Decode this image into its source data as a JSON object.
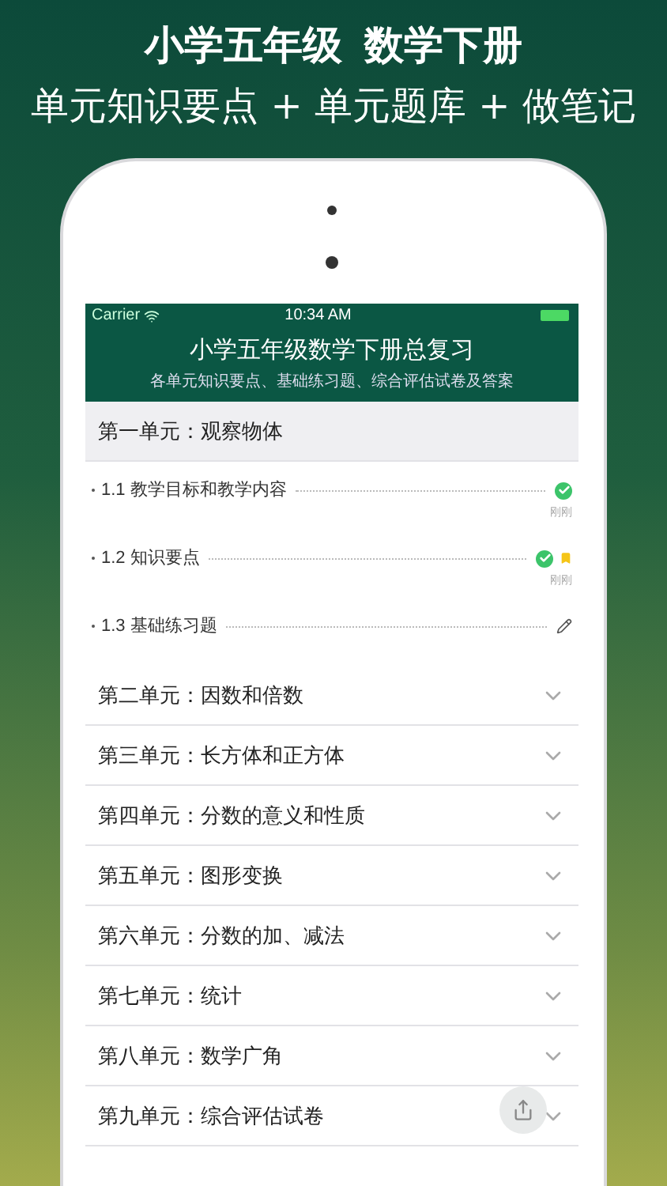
{
  "headline": {
    "title": "小学五年级  数学下册",
    "subtitle": "单元知识要点 + 单元题库 + 做笔记"
  },
  "status_bar": {
    "carrier": "Carrier",
    "time": "10:34 AM"
  },
  "header": {
    "title": "小学五年级数学下册总复习",
    "subtitle": "各单元知识要点、基础练习题、综合评估试卷及答案"
  },
  "units": [
    {
      "label": "第一单元：观察物体",
      "expanded": true,
      "children": [
        {
          "label": "1.1 教学目标和教学内容",
          "done": true,
          "bookmarked": false,
          "time": "刚刚"
        },
        {
          "label": "1.2 知识要点",
          "done": true,
          "bookmarked": true,
          "time": "刚刚"
        },
        {
          "label": "1.3 基础练习题",
          "done": false,
          "bookmarked": false
        }
      ]
    },
    {
      "label": "第二单元：因数和倍数",
      "expanded": false
    },
    {
      "label": "第三单元：长方体和正方体",
      "expanded": false
    },
    {
      "label": "第四单元：分数的意义和性质",
      "expanded": false
    },
    {
      "label": "第五单元：图形变换",
      "expanded": false
    },
    {
      "label": "第六单元：分数的加、减法",
      "expanded": false
    },
    {
      "label": "第七单元：统计",
      "expanded": false
    },
    {
      "label": "第八单元：数学广角",
      "expanded": false
    },
    {
      "label": "第九单元：综合评估试卷",
      "expanded": false
    }
  ]
}
